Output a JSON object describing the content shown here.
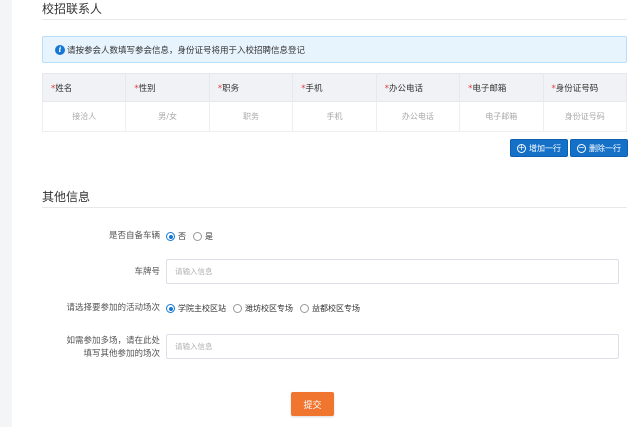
{
  "contact_section": {
    "title": "校招联系人",
    "notice": "请按参会人数填写参会信息，身份证号将用于入校招聘信息登记",
    "columns": [
      {
        "required": "*",
        "label": "姓名"
      },
      {
        "required": "*",
        "label": "性别"
      },
      {
        "required": "*",
        "label": "职务"
      },
      {
        "required": "*",
        "label": "手机"
      },
      {
        "required": "*",
        "label": "办公电话"
      },
      {
        "required": "*",
        "label": "电子邮箱"
      },
      {
        "required": "*",
        "label": "身份证号码"
      }
    ],
    "row_placeholders": [
      "接洽人",
      "男/女",
      "职务",
      "手机",
      "办公电话",
      "电子邮箱",
      "身份证号码"
    ],
    "add_row_label": "增加一行",
    "delete_row_label": "删除一行"
  },
  "other_section": {
    "title": "其他信息",
    "own_car": {
      "label": "是否自备车辆",
      "options": [
        {
          "label": "否",
          "selected": true
        },
        {
          "label": "是",
          "selected": false
        }
      ]
    },
    "plate": {
      "label": "车牌号",
      "placeholder": "请输入信息"
    },
    "activity": {
      "label": "请选择要参加的活动场次",
      "options": [
        {
          "label": "学院主校区站",
          "selected": true
        },
        {
          "label": "潍坊校区专场",
          "selected": false
        },
        {
          "label": "益都校区专场",
          "selected": false
        }
      ]
    },
    "multi": {
      "label_line1": "如需参加多场，请在此处",
      "label_line2": "填写其他参加的场次",
      "placeholder": "请输入信息"
    }
  },
  "submit_label": "提交",
  "colors": {
    "primary": "#1571c8",
    "submit": "#f07630",
    "required": "#e4393c",
    "notice_bg": "#e8f4fd"
  }
}
